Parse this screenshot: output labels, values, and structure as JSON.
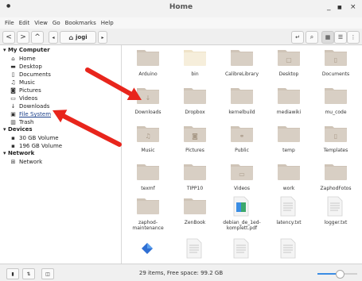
{
  "window": {
    "title": "Home",
    "minimize": "_",
    "close": "×"
  },
  "menu": [
    "File",
    "Edit",
    "View",
    "Go",
    "Bookmarks",
    "Help"
  ],
  "toolbar": {
    "back": "<",
    "forward": ">",
    "up": "^",
    "path_label": "jogi"
  },
  "sidebar": {
    "sections": [
      {
        "title": "My Computer",
        "items": [
          {
            "label": "Home",
            "icon": "home-icon"
          },
          {
            "label": "Desktop",
            "icon": "desktop-icon"
          },
          {
            "label": "Documents",
            "icon": "documents-icon"
          },
          {
            "label": "Music",
            "icon": "music-icon"
          },
          {
            "label": "Pictures",
            "icon": "pictures-icon"
          },
          {
            "label": "Videos",
            "icon": "videos-icon"
          },
          {
            "label": "Downloads",
            "icon": "downloads-icon"
          },
          {
            "label": "File System",
            "icon": "filesystem-icon"
          },
          {
            "label": "Trash",
            "icon": "trash-icon"
          }
        ]
      },
      {
        "title": "Devices",
        "items": [
          {
            "label": "30 GB Volume",
            "icon": "drive-icon"
          },
          {
            "label": "196 GB Volume",
            "icon": "drive-icon"
          }
        ]
      },
      {
        "title": "Network",
        "items": [
          {
            "label": "Network",
            "icon": "network-icon"
          }
        ]
      }
    ]
  },
  "files": [
    {
      "name": "Arduino",
      "kind": "folder"
    },
    {
      "name": "bin",
      "kind": "folder-light"
    },
    {
      "name": "CalibreLibrary",
      "kind": "folder"
    },
    {
      "name": "Desktop",
      "kind": "folder"
    },
    {
      "name": "Documents",
      "kind": "folder"
    },
    {
      "name": "Downloads",
      "kind": "folder"
    },
    {
      "name": "Dropbox",
      "kind": "folder"
    },
    {
      "name": "kernelbuild",
      "kind": "folder"
    },
    {
      "name": "mediawiki",
      "kind": "folder"
    },
    {
      "name": "mu_code",
      "kind": "folder"
    },
    {
      "name": "Music",
      "kind": "folder"
    },
    {
      "name": "Pictures",
      "kind": "folder"
    },
    {
      "name": "Public",
      "kind": "folder"
    },
    {
      "name": "temp",
      "kind": "folder"
    },
    {
      "name": "Templates",
      "kind": "folder"
    },
    {
      "name": "texmf",
      "kind": "folder"
    },
    {
      "name": "TIPP10",
      "kind": "folder"
    },
    {
      "name": "Videos",
      "kind": "folder"
    },
    {
      "name": "work",
      "kind": "folder"
    },
    {
      "name": "ZaphodFotos",
      "kind": "folder"
    },
    {
      "name": "zaphod-maintenance",
      "kind": "folder"
    },
    {
      "name": "ZenBook",
      "kind": "folder"
    },
    {
      "name": "debian_de_1ed-komplett.pdf",
      "kind": "pdf"
    },
    {
      "name": "latency.txt",
      "kind": "txt"
    },
    {
      "name": "logger.txt",
      "kind": "txt"
    },
    {
      "name": "",
      "kind": "app"
    },
    {
      "name": "",
      "kind": "txt"
    },
    {
      "name": "",
      "kind": "txt"
    },
    {
      "name": "",
      "kind": "txt"
    }
  ],
  "status": {
    "text": "29 items, Free space: 99.2 GB"
  },
  "zoom": {
    "level": 0.55
  },
  "colors": {
    "folder": "#d8cfc4",
    "folder_tab": "#cfc4b7",
    "accent": "#3b8de4",
    "arrow": "#e8251c"
  }
}
